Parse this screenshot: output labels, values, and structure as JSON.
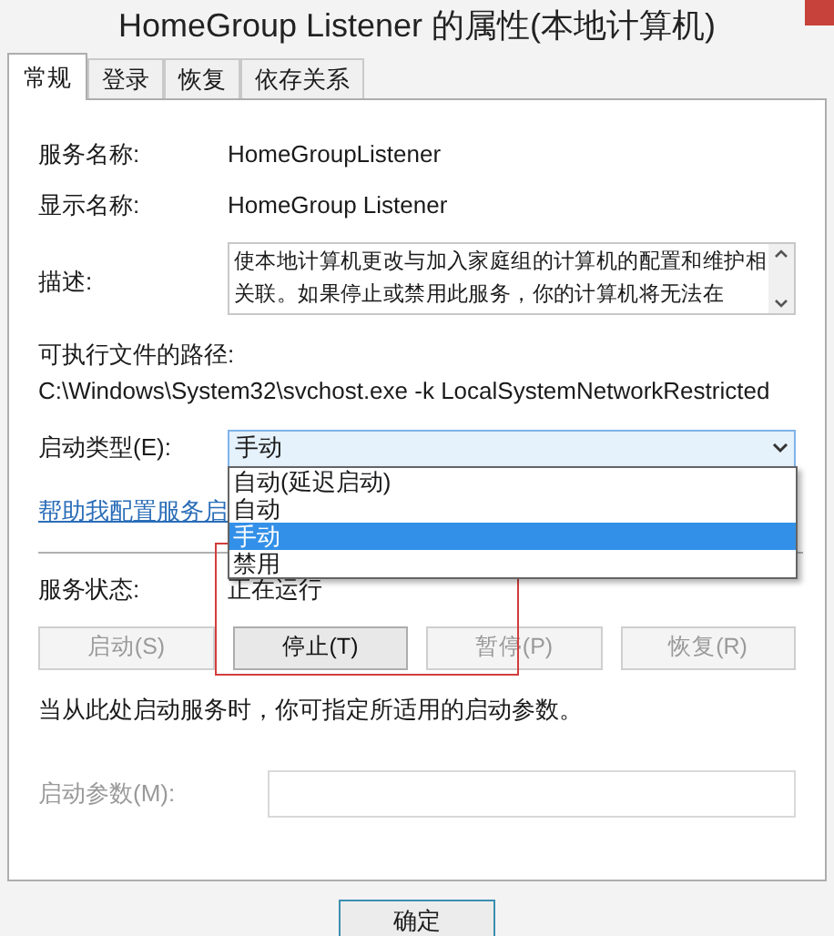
{
  "window": {
    "title": "HomeGroup Listener 的属性(本地计算机)"
  },
  "tabs": [
    {
      "label": "常规",
      "selected": true
    },
    {
      "label": "登录",
      "selected": false
    },
    {
      "label": "恢复",
      "selected": false
    },
    {
      "label": "依存关系",
      "selected": false
    }
  ],
  "fields": [
    {
      "label": "服务名称:",
      "value": "HomeGroupListener"
    },
    {
      "label": "显示名称:",
      "value": "HomeGroup Listener"
    }
  ],
  "description": {
    "label": "描述:",
    "text": "使本地计算机更改与加入家庭组的计算机的配置和维护相关联。如果停止或禁用此服务，你的计算机将无法在"
  },
  "executable": {
    "label": "可执行文件的路径:",
    "path": "C:\\Windows\\System32\\svchost.exe -k LocalSystemNetworkRestricted"
  },
  "startup_type": {
    "label": "启动类型(E):",
    "value": "手动",
    "expanded": true,
    "options": [
      {
        "label": "自动(延迟启动)",
        "selected": false
      },
      {
        "label": "自动",
        "selected": false
      },
      {
        "label": "手动",
        "selected": true
      },
      {
        "label": "禁用",
        "selected": false
      }
    ]
  },
  "help_link": "帮助我配置服务启",
  "service_status": {
    "label": "服务状态:",
    "value": "正在运行"
  },
  "buttons": [
    {
      "label": "启动(S)",
      "disabled": true
    },
    {
      "label": "停止(T)",
      "disabled": false
    },
    {
      "label": "暂停(P)",
      "disabled": true
    },
    {
      "label": "恢复(R)",
      "disabled": true
    }
  ],
  "hint": "当从此处启动服务时，你可指定所适用的启动参数。",
  "start_parameters": {
    "label": "启动参数(M):",
    "disabled": true
  },
  "footer_buttons": [
    "确定"
  ]
}
